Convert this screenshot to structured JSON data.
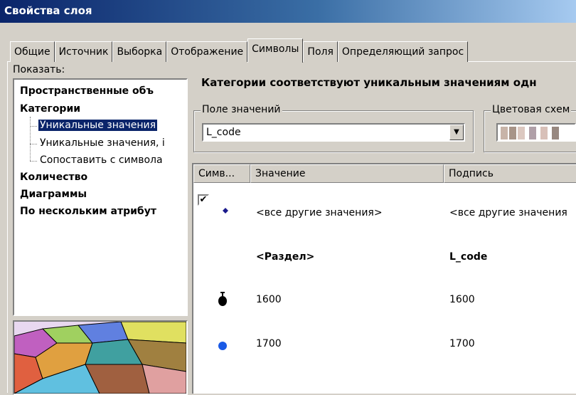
{
  "window": {
    "title": "Свойства слоя"
  },
  "tabs": [
    {
      "label": "Общие"
    },
    {
      "label": "Источник"
    },
    {
      "label": "Выборка"
    },
    {
      "label": "Отображение"
    },
    {
      "label": "Символы",
      "active": true
    },
    {
      "label": "Поля"
    },
    {
      "label": "Определяющий запрос"
    }
  ],
  "show": {
    "label": "Показать:",
    "tree": [
      {
        "label": "Пространственные объ",
        "bold": true
      },
      {
        "label": "Категории",
        "bold": true
      },
      {
        "label": "Уникальные значения",
        "selected": true
      },
      {
        "label": "Уникальные значения, i"
      },
      {
        "label": "Сопоставить с символа"
      },
      {
        "label": "Количество",
        "bold": true
      },
      {
        "label": "Диаграммы",
        "bold": true
      },
      {
        "label": "По нескольким атрибут",
        "bold": true
      }
    ]
  },
  "main": {
    "heading": "Категории соответствуют уникальным значениям одн",
    "value_field": {
      "label": "Поле значений",
      "value": "L_code"
    },
    "color_scheme": {
      "label": "Цветовая схем",
      "swatches": [
        "#c8b4a8",
        "#a89488",
        "#dcc8c0",
        "#b0a0a8",
        "#d8c0b8",
        "#988880"
      ]
    }
  },
  "table": {
    "headers": [
      "Симв...",
      "Значение",
      "Подпись"
    ],
    "rows": [
      {
        "symbol": "small-dot-icon",
        "color": "#1a1a8c",
        "value": "<все другие значения>",
        "label": "<все другие значения",
        "checked": true
      },
      {
        "symbol": "",
        "value": "<Раздел>",
        "label": "L_code",
        "bold": true
      },
      {
        "symbol": "bomb-marker-icon",
        "color": "#000000",
        "value": "1600",
        "label": "1600"
      },
      {
        "symbol": "circle-icon",
        "color": "#1a5ae6",
        "value": "1700",
        "label": "1700"
      }
    ]
  }
}
